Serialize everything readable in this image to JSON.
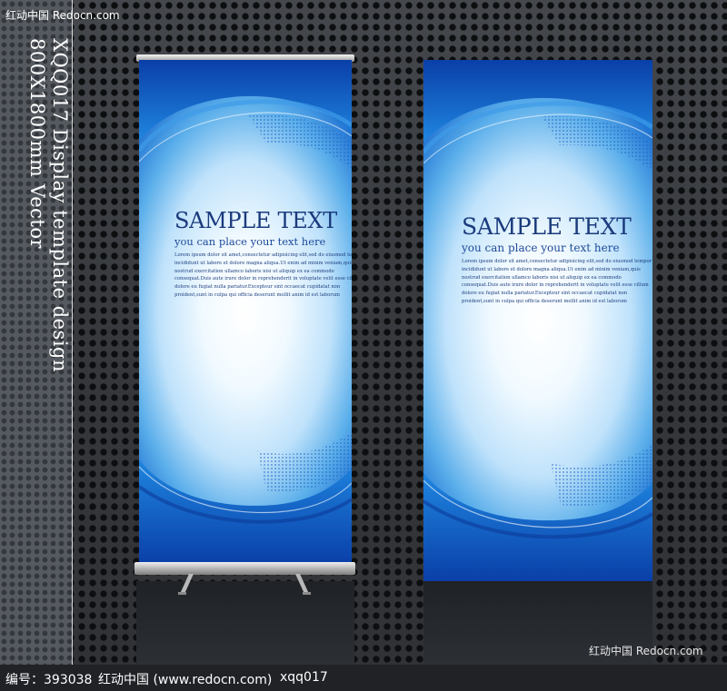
{
  "watermark_top": "红动中国 Redocn.com",
  "watermark_bottom": "红动中国 Redocn.com",
  "side_text": {
    "line1": "XQQ017 Display template design",
    "line2": "800X1800mm Vector"
  },
  "banners": [
    {
      "title": "SAMPLE TEXT",
      "subtitle": "you can place your text here",
      "body_lines": [
        "Lorem ipsum dolor sit amet,consectetur adipisicing elit,sed do eiusmod tempor",
        "incididunt ut labore et dolore magna aliqua.Ut enim ad minim veniam,quis",
        "nostrud exercitation ullamco laboris nisi ut aliquip ex ea commodo",
        "consequat.Duis aute irure dolor in reprehenderit in voluptate velit esse cillum",
        "dolore eu fugiat nulla pariatur.Excepteur sint occaecat cupidatat non",
        "proident,sunt in culpa qui officia deserunt mollit anim id est laborum"
      ]
    },
    {
      "title": "SAMPLE TEXT",
      "subtitle": "you can place your text here",
      "body_lines": [
        "Lorem ipsum dolor sit amet,consectetur adipisicing elit,sed do eiusmod tempor",
        "incididunt ut labore et dolore magna aliqua.Ut enim ad minim veniam,quis",
        "nostrud exercitation ullamco laboris nisi ut aliquip ex ea commodo",
        "consequat.Duis aute irure dolor in reprehenderit in voluptate velit esse cillum",
        "dolore eu fugiat nulla pariatur.Excepteur sint occaecat cupidatat non",
        "proident,sunt in culpa qui officia deserunt mollit anim id est laborum"
      ]
    }
  ],
  "caption": {
    "id_label": "编号：393038",
    "site": "红动中国 (www.redocn.com)",
    "code": "xqq017"
  },
  "colors": {
    "banner_blue": "#1d6fd0",
    "title_navy": "#1a3a7c",
    "background": "#3a3c41"
  }
}
